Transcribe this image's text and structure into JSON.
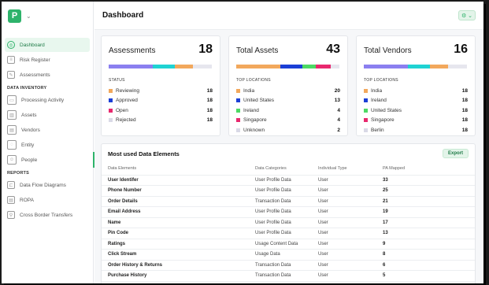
{
  "app": {
    "logo_letter": "P"
  },
  "sidebar": {
    "items": [
      {
        "label": "Dashboard",
        "icon": "dashboard-icon",
        "glyph": "◎"
      },
      {
        "label": "Risk Register",
        "icon": "risk-register-icon",
        "glyph": "≡"
      },
      {
        "label": "Assessments",
        "icon": "assessments-icon",
        "glyph": "✎"
      }
    ],
    "section_inventory": "DATA INVENTORY",
    "inventory_items": [
      {
        "label": "Processing Activity",
        "icon": "folder-icon",
        "glyph": "▭"
      },
      {
        "label": "Assets",
        "icon": "assets-icon",
        "glyph": "▥"
      },
      {
        "label": "Vendors",
        "icon": "vendors-icon",
        "glyph": "▤"
      },
      {
        "label": "Entity",
        "icon": "entity-icon",
        "glyph": "◌"
      },
      {
        "label": "People",
        "icon": "people-icon",
        "glyph": "☺"
      }
    ],
    "section_reports": "REPORTS",
    "report_items": [
      {
        "label": "Data Flow Diagrams",
        "icon": "data-flow-icon",
        "glyph": "⊏"
      },
      {
        "label": "ROPA",
        "icon": "ropa-icon",
        "glyph": "▤"
      },
      {
        "label": "Cross Border Transfers",
        "icon": "cross-border-icon",
        "glyph": "⚲"
      }
    ]
  },
  "header": {
    "title": "Dashboard",
    "settings_glyph": "⚙ ⌄"
  },
  "cards": [
    {
      "title": "Assessments",
      "count": "18",
      "bar": [
        {
          "color": "#8b7ff0",
          "pct": 43
        },
        {
          "color": "#1fd3d3",
          "pct": 21
        },
        {
          "color": "#f2a85c",
          "pct": 18
        },
        {
          "color": "#e6e6ee",
          "pct": 18
        }
      ],
      "legend_title": "STATUS",
      "legend": [
        {
          "label": "Reviewing",
          "value": "18",
          "color": "#f2a85c"
        },
        {
          "label": "Approved",
          "value": "18",
          "color": "#1b3fd6"
        },
        {
          "label": "Open",
          "value": "18",
          "color": "#e8286e"
        },
        {
          "label": "Rejected",
          "value": "18",
          "color": "#d9d9e6"
        }
      ]
    },
    {
      "title": "Total Assets",
      "count": "43",
      "bar": [
        {
          "color": "#f2a85c",
          "pct": 43
        },
        {
          "color": "#1b3fd6",
          "pct": 21
        },
        {
          "color": "#4cd964",
          "pct": 13
        },
        {
          "color": "#e8286e",
          "pct": 15
        },
        {
          "color": "#e6e6ee",
          "pct": 8
        }
      ],
      "legend_title": "TOP LOCATIONS",
      "legend": [
        {
          "label": "India",
          "value": "20",
          "color": "#f2a85c"
        },
        {
          "label": "United States",
          "value": "13",
          "color": "#1b3fd6"
        },
        {
          "label": "Ireland",
          "value": "4",
          "color": "#4cd964"
        },
        {
          "label": "Singapore",
          "value": "4",
          "color": "#e8286e"
        },
        {
          "label": "Unknown",
          "value": "2",
          "color": "#d9d9e6"
        }
      ]
    },
    {
      "title": "Total Vendors",
      "count": "16",
      "bar": [
        {
          "color": "#8b7ff0",
          "pct": 43
        },
        {
          "color": "#1fd3d3",
          "pct": 21
        },
        {
          "color": "#f2a85c",
          "pct": 18
        },
        {
          "color": "#e6e6ee",
          "pct": 18
        }
      ],
      "legend_title": "TOP LOCATIONS",
      "legend": [
        {
          "label": "India",
          "value": "18",
          "color": "#f2a85c"
        },
        {
          "label": "Ireland",
          "value": "18",
          "color": "#1b3fd6"
        },
        {
          "label": "United States",
          "value": "18",
          "color": "#4cd964"
        },
        {
          "label": "Singapore",
          "value": "18",
          "color": "#e8286e"
        },
        {
          "label": "Berlin",
          "value": "18",
          "color": "#d9d9e6"
        }
      ]
    }
  ],
  "table": {
    "title": "Most used Data Elements",
    "export_label": "Export",
    "columns": [
      "Data Elements",
      "Data Categories",
      "Individual Type",
      "PA Mapped"
    ],
    "rows": [
      [
        "User Identifer",
        "User Profile Data",
        "User",
        "33"
      ],
      [
        "Phone Number",
        "User Profile Data",
        "User",
        "25"
      ],
      [
        "Order Details",
        "Transaction Data",
        "User",
        "21"
      ],
      [
        "Email Address",
        "User Profile Data",
        "User",
        "19"
      ],
      [
        "Name",
        "User Profile Data",
        "User",
        "17"
      ],
      [
        "Pin Code",
        "User Profile Data",
        "User",
        "13"
      ],
      [
        "Ratings",
        "Usage Content Data",
        "User",
        "9"
      ],
      [
        "Click Stream",
        "Usage Data",
        "User",
        "8"
      ],
      [
        "Order History & Returns",
        "Transaction Data",
        "User",
        "6"
      ],
      [
        "Purchase History",
        "Transaction Data",
        "User",
        "5"
      ]
    ]
  }
}
